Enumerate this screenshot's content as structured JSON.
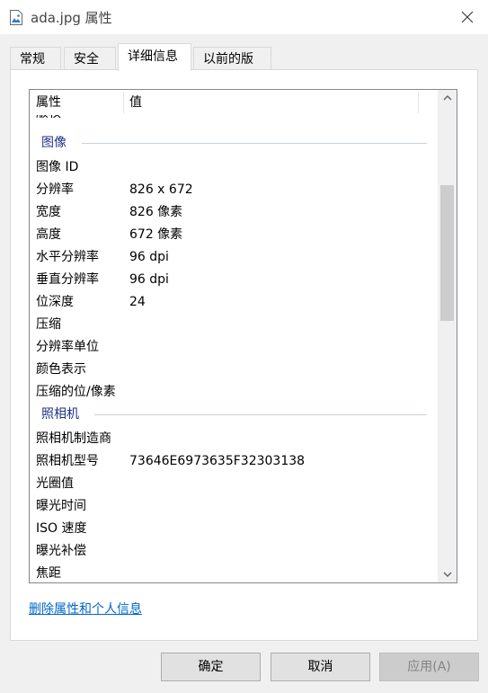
{
  "window": {
    "title": "ada.jpg 属性",
    "icon": "image-file-icon"
  },
  "tabs": [
    {
      "label": "常规"
    },
    {
      "label": "安全"
    },
    {
      "label": "详细信息",
      "active": true
    },
    {
      "label": "以前的版本"
    }
  ],
  "list": {
    "headers": {
      "name": "属性",
      "value": "值"
    },
    "partial_row": "版权",
    "groups": [
      {
        "title": "图像",
        "rows": [
          {
            "name": "图像 ID",
            "value": ""
          },
          {
            "name": "分辨率",
            "value": "826 x 672"
          },
          {
            "name": "宽度",
            "value": "826 像素"
          },
          {
            "name": "高度",
            "value": "672 像素"
          },
          {
            "name": "水平分辨率",
            "value": "96 dpi"
          },
          {
            "name": "垂直分辨率",
            "value": "96 dpi"
          },
          {
            "name": "位深度",
            "value": "24"
          },
          {
            "name": "压缩",
            "value": ""
          },
          {
            "name": "分辨率单位",
            "value": ""
          },
          {
            "name": "颜色表示",
            "value": ""
          },
          {
            "name": "压缩的位/像素",
            "value": ""
          }
        ]
      },
      {
        "title": "照相机",
        "rows": [
          {
            "name": "照相机制造商",
            "value": ""
          },
          {
            "name": "照相机型号",
            "value": "73646E6973635F32303138"
          },
          {
            "name": "光圈值",
            "value": ""
          },
          {
            "name": "曝光时间",
            "value": ""
          },
          {
            "name": "ISO 速度",
            "value": ""
          },
          {
            "name": "曝光补偿",
            "value": ""
          },
          {
            "name": "焦距",
            "value": ""
          }
        ]
      }
    ]
  },
  "link": {
    "label": "删除属性和个人信息"
  },
  "buttons": {
    "ok": "确定",
    "cancel": "取消",
    "apply": "应用(A)"
  },
  "colors": {
    "group_title": "#1e3287",
    "link": "#0066cc",
    "accent": "#0078d7"
  }
}
